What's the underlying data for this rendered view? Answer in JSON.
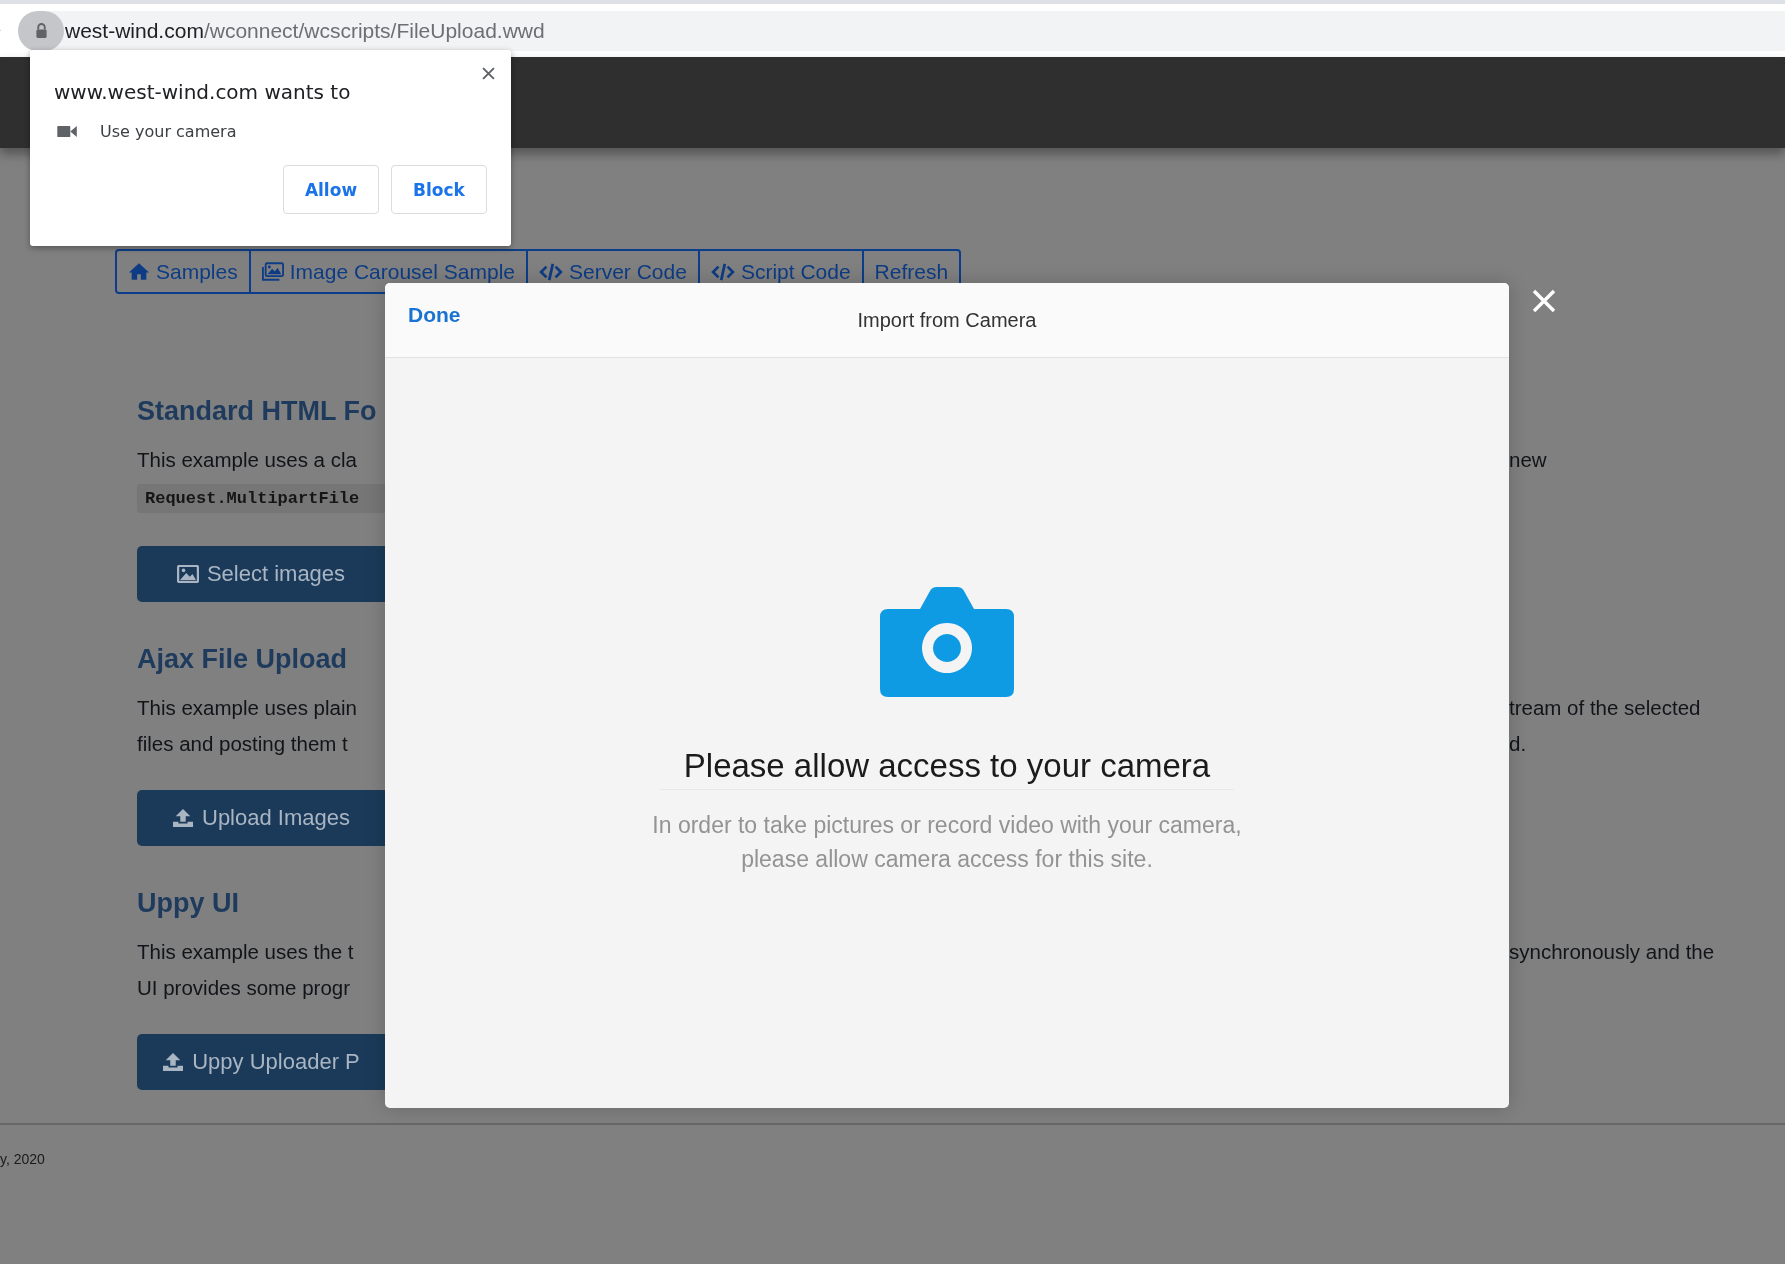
{
  "browser": {
    "url_host": "west-wind.com",
    "url_path": "/wconnect/wcscripts/FileUpload.wwd"
  },
  "permission_prompt": {
    "title": "www.west-wind.com wants to",
    "request": "Use your camera",
    "buttons": [
      {
        "label": "Allow"
      },
      {
        "label": "Block"
      }
    ]
  },
  "tabs": [
    {
      "label": "Samples",
      "kind": "home"
    },
    {
      "label": "Image Carousel Sample",
      "kind": "images"
    },
    {
      "label": "Server Code",
      "kind": "code"
    },
    {
      "label": "Script Code",
      "kind": "code"
    },
    {
      "label": "Refresh",
      "kind": "plain"
    }
  ],
  "sections": [
    {
      "heading": "Standard HTML Fo",
      "lines": [
        {
          "left": "This example uses a cla",
          "right": "new"
        }
      ],
      "code": "Request.MultipartFile",
      "button": {
        "label": "Select images",
        "kind": "picture"
      }
    },
    {
      "heading": "Ajax File Upload",
      "lines": [
        {
          "left": "This example uses plain",
          "right": "tream of the selected"
        },
        {
          "left": "files and posting them t",
          "right": "d."
        }
      ],
      "button": {
        "label": "Upload Images",
        "kind": "upload"
      }
    },
    {
      "heading": "Uppy UI",
      "lines": [
        {
          "left": "This example uses the t",
          "right": "synchronously and the"
        },
        {
          "left": "UI provides some progr"
        }
      ],
      "button": {
        "label": "Uppy Uploader P",
        "kind": "upload"
      }
    }
  ],
  "footer": {
    "text": "y, 2020"
  },
  "modal": {
    "done": "Done",
    "title": "Import from Camera",
    "heading": "Please allow access to your camera",
    "message_lines": [
      "In order to take pictures or record video with your camera,",
      "please allow camera access for this site."
    ]
  }
}
